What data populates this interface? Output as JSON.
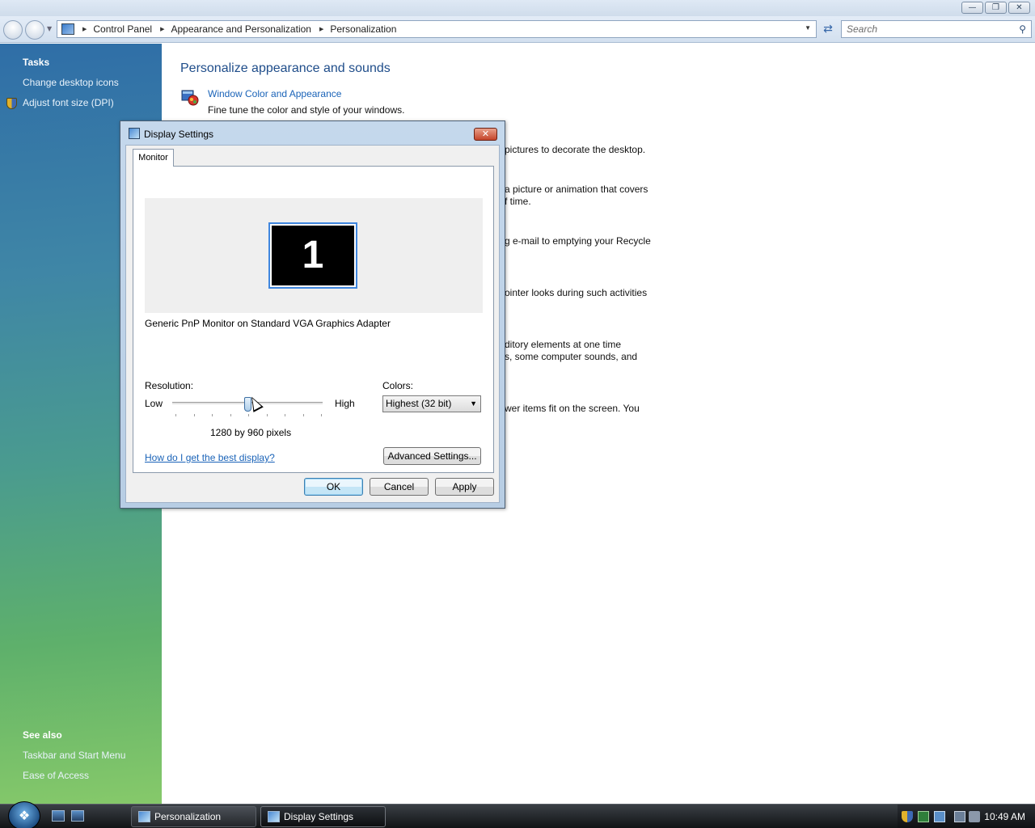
{
  "window": {
    "minimize_icon": "minimize-icon",
    "restore_icon": "restore-icon",
    "close_icon": "close-icon"
  },
  "address_bar": {
    "breadcrumbs": [
      "Control Panel",
      "Appearance and Personalization",
      "Personalization"
    ],
    "search_placeholder": "Search"
  },
  "sidebar": {
    "tasks_heading": "Tasks",
    "tasks": [
      "Change desktop icons",
      "Adjust font size (DPI)"
    ],
    "see_also_heading": "See also",
    "see_also": [
      "Taskbar and Start Menu",
      "Ease of Access"
    ]
  },
  "main": {
    "title": "Personalize appearance and sounds",
    "first_item": {
      "link": "Window Color and Appearance",
      "description": "Fine tune the color and style of your windows."
    },
    "obscured_lines": [
      "pictures to decorate the desktop.",
      "a picture or animation that covers",
      "f time.",
      "g e-mail to emptying your Recycle",
      "ointer looks during such activities",
      "ditory elements at one time",
      "s, some computer sounds, and",
      "wer items fit on the screen. You"
    ]
  },
  "dialog": {
    "title": "Display Settings",
    "tab": "Monitor",
    "monitor_number": "1",
    "monitor_description": "Generic PnP Monitor on Standard VGA Graphics Adapter",
    "resolution_label": "Resolution:",
    "low_label": "Low",
    "high_label": "High",
    "resolution_value": "1280 by 960 pixels",
    "resolution_slider_fraction": 0.5,
    "colors_label": "Colors:",
    "colors_value": "Highest (32 bit)",
    "help_link": "How do I get the best display?",
    "advanced_button": "Advanced Settings...",
    "ok_button": "OK",
    "cancel_button": "Cancel",
    "apply_button": "Apply"
  },
  "taskbar": {
    "buttons": [
      "Personalization",
      "Display Settings"
    ],
    "clock": "10:49 AM"
  },
  "colors": {
    "link": "#1a63b8",
    "title": "#1f4d8a",
    "close_red": "#c4442a"
  }
}
